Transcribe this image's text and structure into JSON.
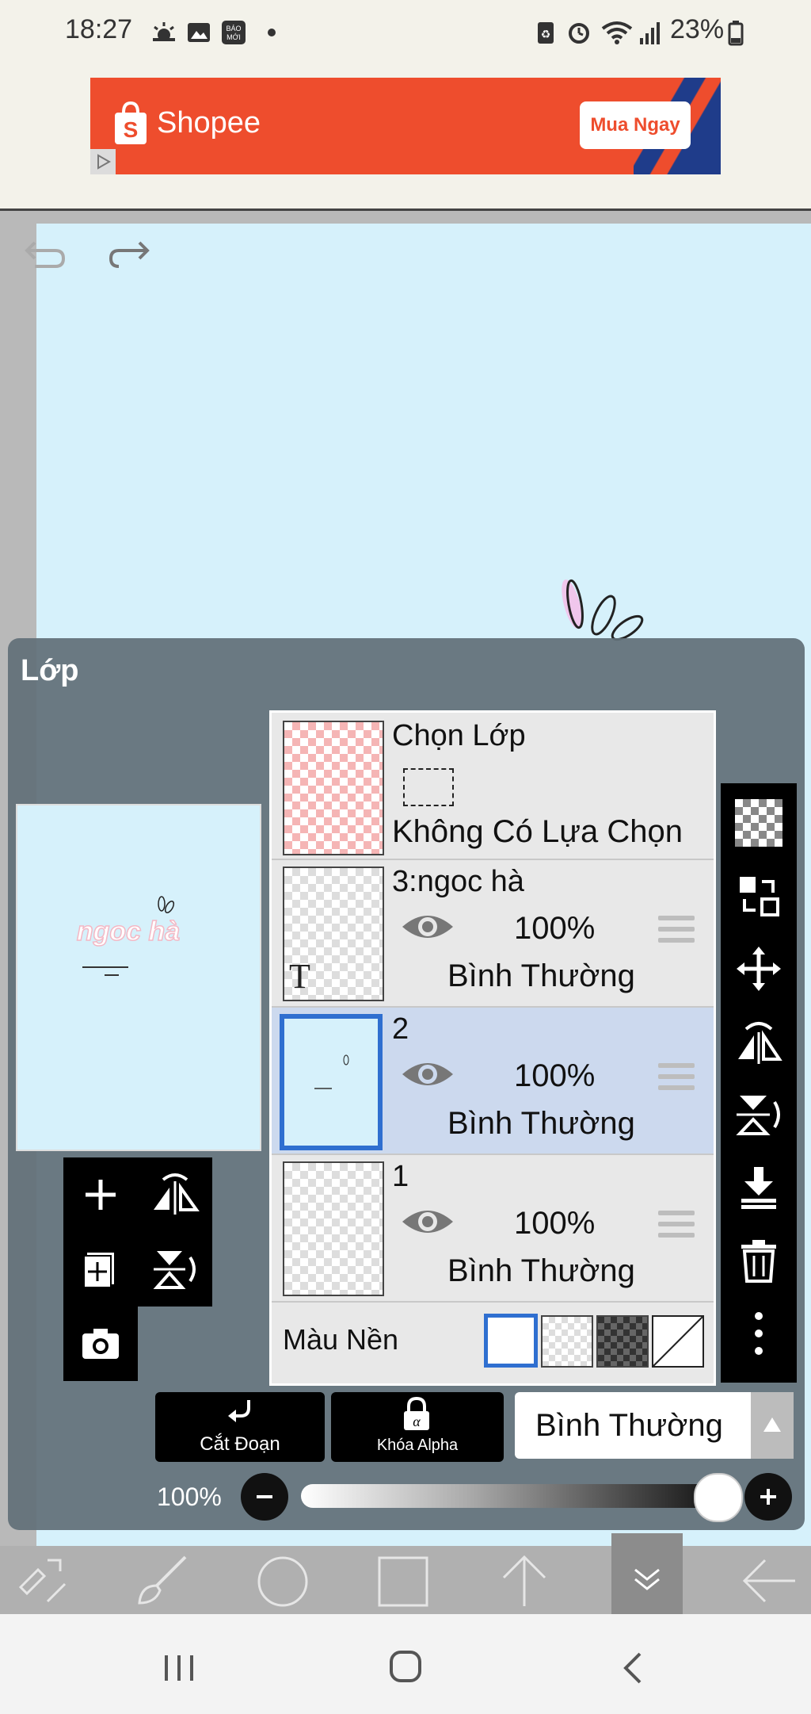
{
  "status_bar": {
    "time": "18:27",
    "battery": "23%",
    "left_icons": [
      "weather-icon",
      "gallery-icon",
      "baomoi-icon",
      "dot-icon"
    ],
    "right_icons": [
      "battery-saver-icon",
      "alarm-icon",
      "wifi-icon",
      "signal-icon",
      "battery-icon"
    ]
  },
  "ad": {
    "brand": "Shopee",
    "cta": "Mua Ngay",
    "color": "#ee4d2d"
  },
  "panel": {
    "title": "Lớp",
    "selection_row": {
      "title": "Chọn Lớp",
      "status": "Không Có Lựa Chọn"
    },
    "layers": [
      {
        "name": "3:ngoc hà",
        "opacity": "100%",
        "mode": "Bình Thường",
        "type": "text",
        "selected": false
      },
      {
        "name": "2",
        "opacity": "100%",
        "mode": "Bình Thường",
        "type": "image",
        "selected": true
      },
      {
        "name": "1",
        "opacity": "100%",
        "mode": "Bình Thường",
        "type": "image",
        "selected": false
      }
    ],
    "background": {
      "label": "Màu Nền",
      "options": [
        "white",
        "transparent",
        "dark-checker",
        "none"
      ],
      "selected": "white"
    },
    "clip_button": "Cắt Đoạn",
    "alpha_lock_button": "Khóa Alpha",
    "blend_mode": "Bình Thường",
    "opacity_label": "100%",
    "opacity_value": 100
  },
  "colors": {
    "canvas": "#d6f1fb",
    "panel": "#627078",
    "selected_layer": "#ccd9ee",
    "selected_border": "#2f6fd0"
  }
}
